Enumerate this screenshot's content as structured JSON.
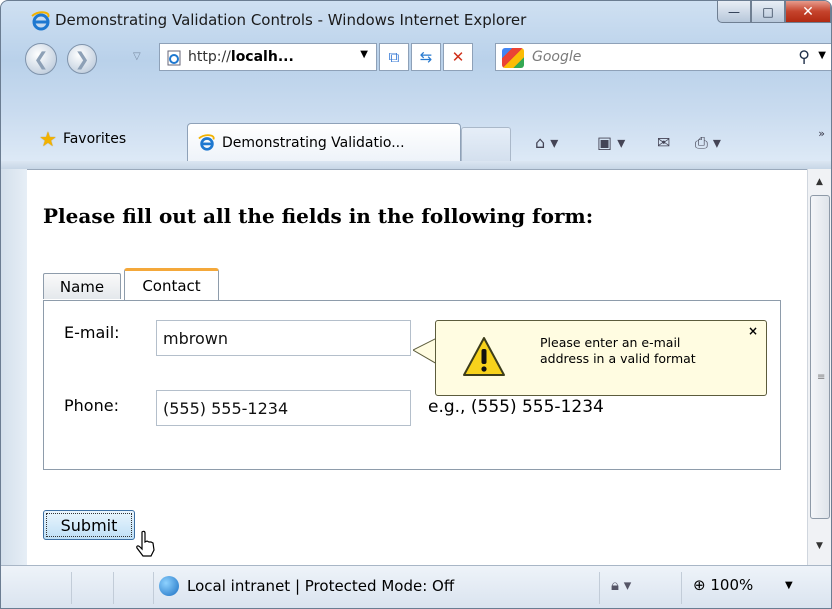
{
  "window": {
    "title": "Demonstrating Validation Controls - Windows Internet Explorer",
    "min": "—",
    "max": "□",
    "close": "✕"
  },
  "nav": {
    "back": "❮",
    "forward": "❯",
    "url_prefix": "http://",
    "url_host": "localh...",
    "search_placeholder": "Google"
  },
  "favorites": {
    "label": "Favorites",
    "tab_title": "Demonstrating Validatio..."
  },
  "page": {
    "heading": "Please fill out all the fields in the following form:",
    "tabs": [
      {
        "label": "Name"
      },
      {
        "label": "Contact"
      }
    ],
    "active_tab": "Contact",
    "email_label": "E-mail:",
    "email_value": "mbrown",
    "phone_label": "Phone:",
    "phone_value": "(555) 555-1234",
    "phone_hint": "e.g., (555) 555-1234",
    "balloon_message": "Please enter an e-mail address in a valid format",
    "balloon_close": "×",
    "submit_label": "Submit"
  },
  "status": {
    "zone": "Local intranet | Protected Mode: Off",
    "zoom": "100%"
  }
}
